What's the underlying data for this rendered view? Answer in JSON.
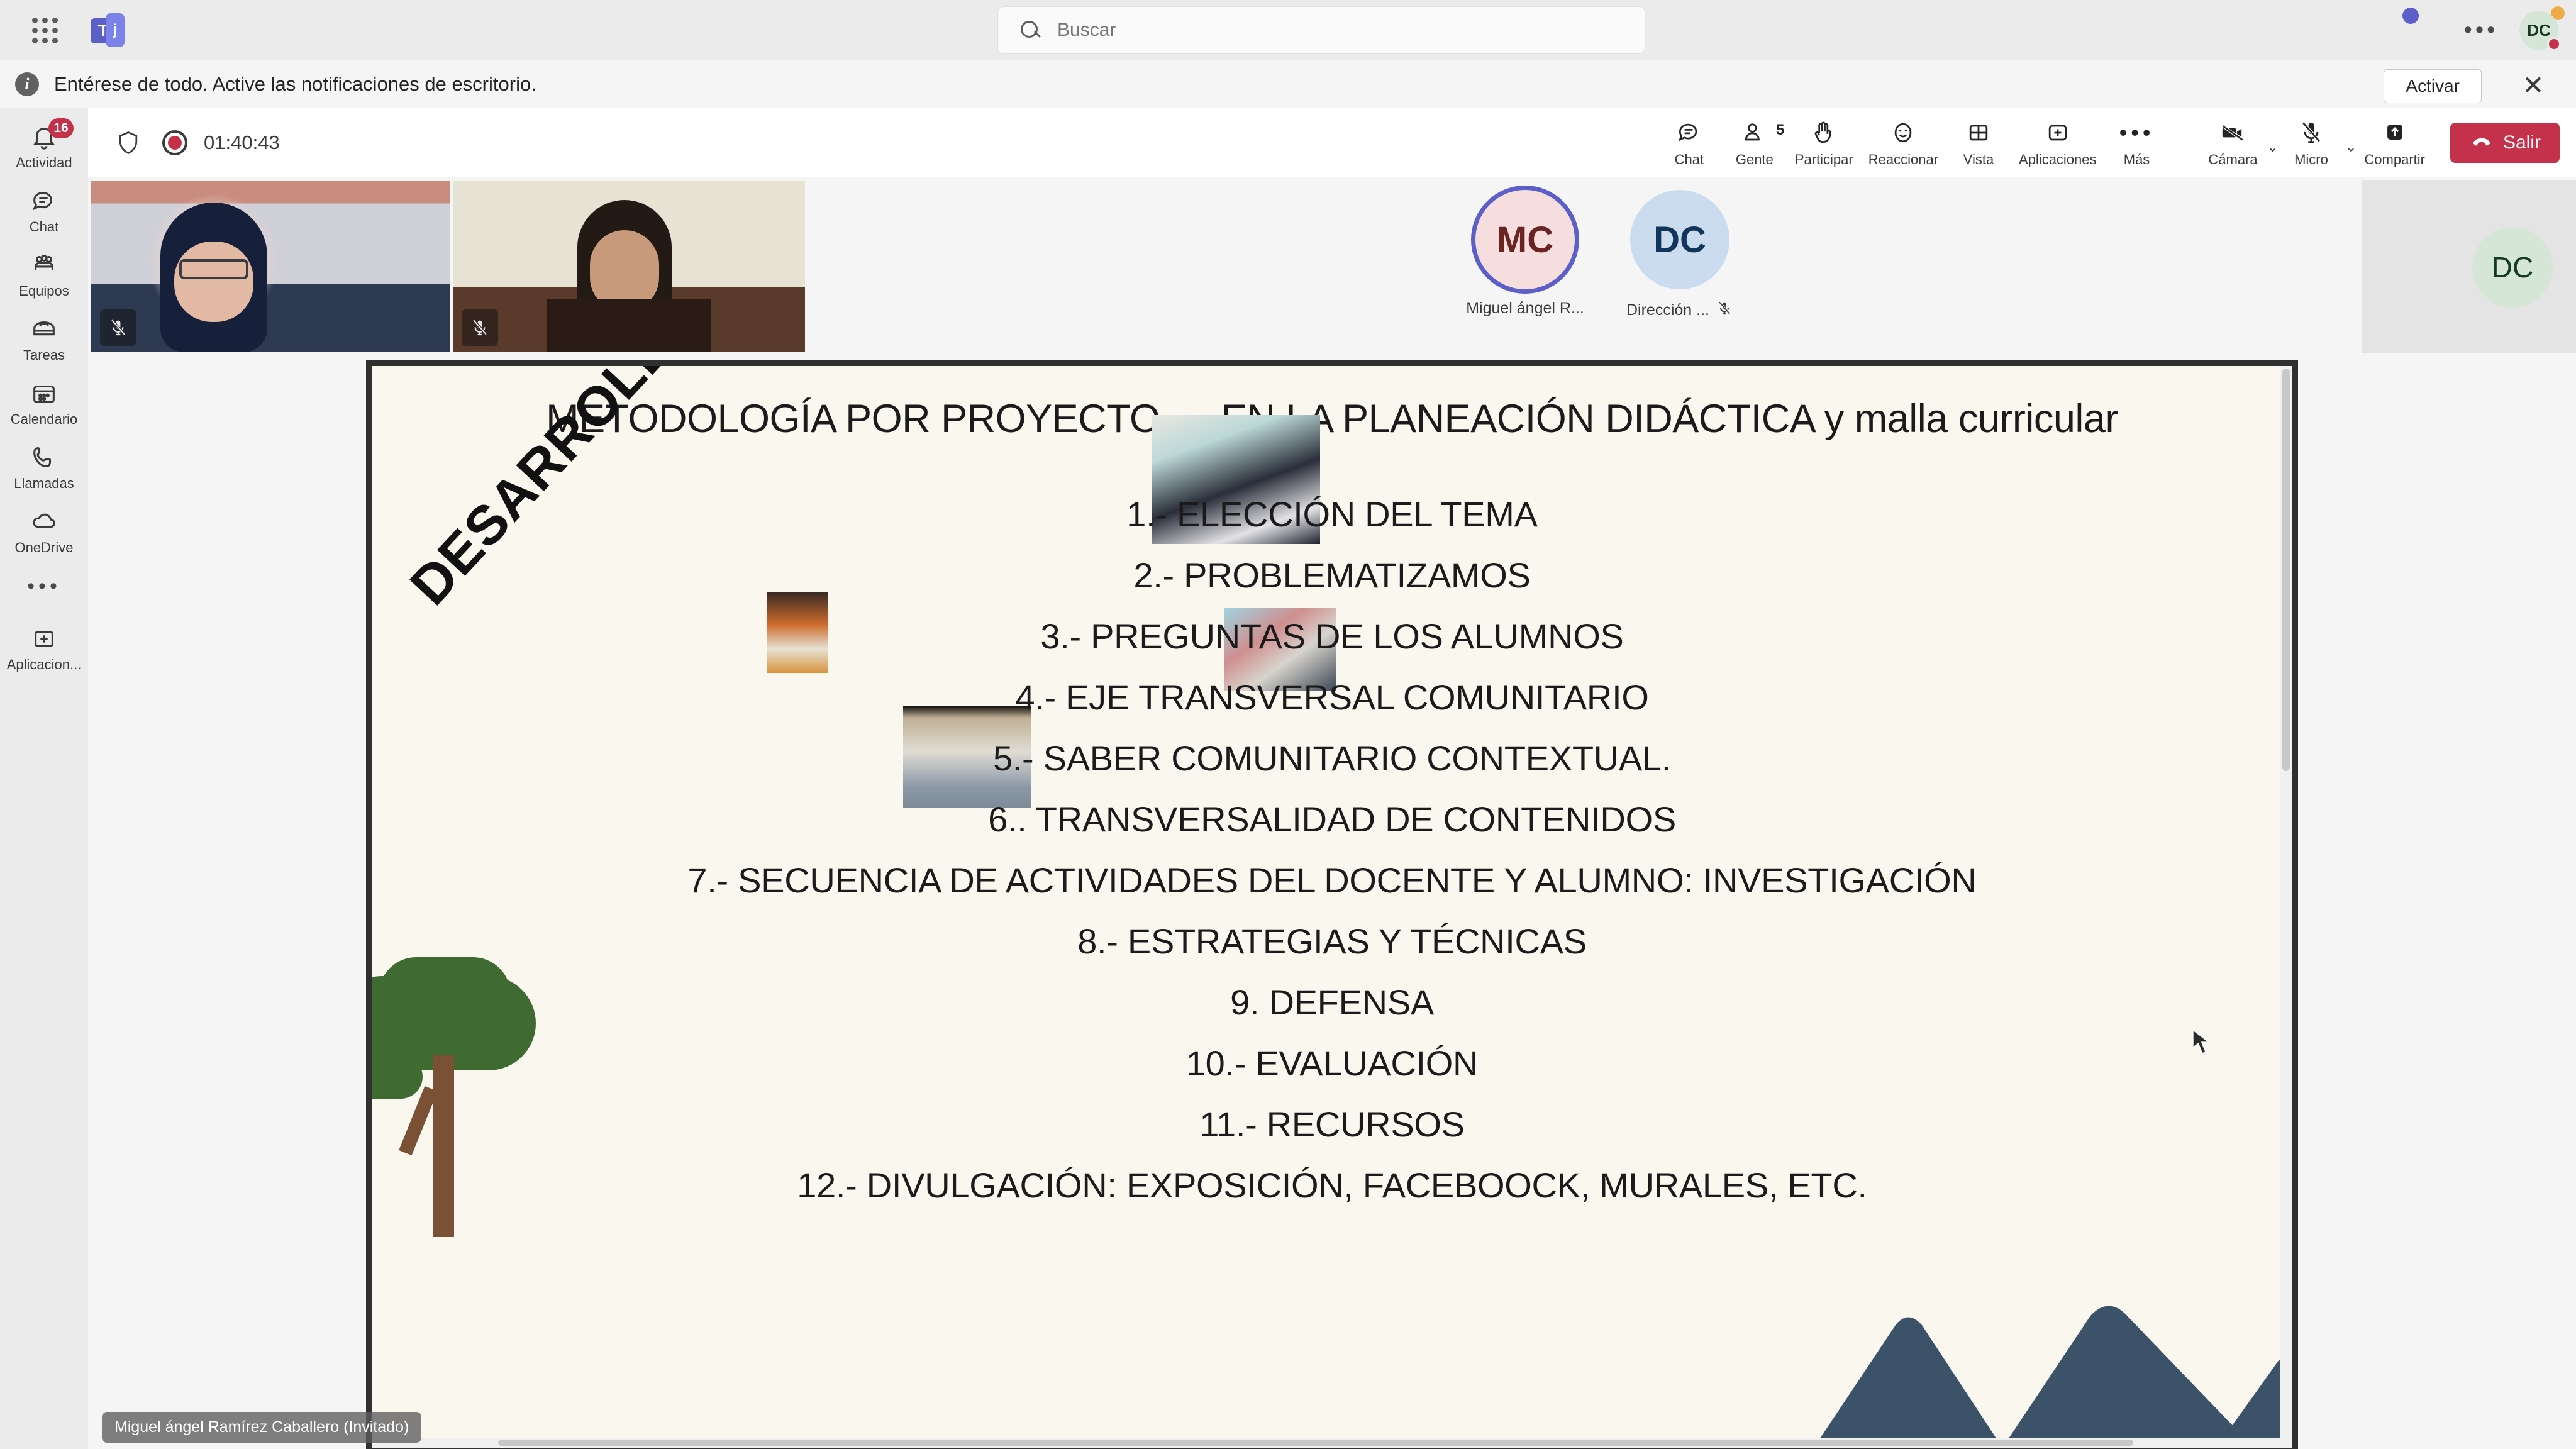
{
  "app": {
    "name": "Microsoft Teams",
    "logo_letter": "T"
  },
  "topbar": {
    "waffle_icon": "grid-waffle-icon",
    "search": {
      "placeholder": "Buscar",
      "value": "",
      "icon": "search-icon"
    },
    "more_icon": "ellipsis-icon",
    "account_initials": "DC",
    "presence": "busy"
  },
  "notification": {
    "icon": "info-icon",
    "text": "Entérese de todo. Active las notificaciones de escritorio.",
    "action_label": "Activar",
    "close_icon": "close-icon"
  },
  "sidebar": {
    "items": [
      {
        "label": "Actividad",
        "icon": "bell-icon",
        "badge": "16"
      },
      {
        "label": "Chat",
        "icon": "chat-bubble-icon",
        "badge": ""
      },
      {
        "label": "Equipos",
        "icon": "people-team-icon",
        "badge": ""
      },
      {
        "label": "Tareas",
        "icon": "briefcase-icon",
        "badge": ""
      },
      {
        "label": "Calendario",
        "icon": "calendar-icon",
        "badge": ""
      },
      {
        "label": "Llamadas",
        "icon": "phone-icon",
        "badge": ""
      },
      {
        "label": "OneDrive",
        "icon": "cloud-icon",
        "badge": ""
      }
    ],
    "more_icon": "ellipsis-icon",
    "apps": {
      "label": "Aplicacion...",
      "icon": "plus-box-icon"
    }
  },
  "meeting_toolbar": {
    "shield_icon": "shield-icon",
    "recording_icon": "recording-dot-icon",
    "timer": "01:40:43",
    "buttons": [
      {
        "label": "Chat",
        "icon": "chat-bubble-icon",
        "count": ""
      },
      {
        "label": "Gente",
        "icon": "person-icon",
        "count": "5"
      },
      {
        "label": "Participar",
        "icon": "raise-hand-icon",
        "count": ""
      },
      {
        "label": "Reaccionar",
        "icon": "smiley-icon",
        "count": ""
      },
      {
        "label": "Vista",
        "icon": "grid-view-icon",
        "count": ""
      },
      {
        "label": "Aplicaciones",
        "icon": "plus-box-icon",
        "count": ""
      },
      {
        "label": "Más",
        "icon": "ellipsis-icon",
        "count": ""
      }
    ],
    "media": [
      {
        "label": "Cámara",
        "icon": "camera-off-icon",
        "has_chevron": true
      },
      {
        "label": "Micro",
        "icon": "mic-off-icon",
        "has_chevron": true
      },
      {
        "label": "Compartir",
        "icon": "share-up-arrow-icon",
        "has_chevron": false
      }
    ],
    "leave": {
      "label": "Salir",
      "icon": "hang-up-icon",
      "color": "#c4314b"
    }
  },
  "stage": {
    "video_tiles": [
      {
        "name": "",
        "muted_icon": "mic-off-icon"
      },
      {
        "name": "",
        "muted_icon": "mic-off-icon"
      }
    ],
    "participants": [
      {
        "initials": "MC",
        "name": "Miguel ángel R...",
        "speaking": true,
        "muted": false
      },
      {
        "initials": "DC",
        "name": "Dirección ...",
        "speaking": false,
        "muted": true,
        "muted_icon": "mic-off-icon"
      }
    ],
    "right_tile": {
      "initials": "DC"
    },
    "active_speaker_label": "Miguel ángel Ramírez Caballero (Invitado)",
    "cursor_icon": "mouse-pointer-icon"
  },
  "slide": {
    "title": "METODOLOGÍA POR PROYECTO…. EN LA PLANEACIÓN DIDÁCTICA y malla curricular",
    "rotated_label": "DESARROLLO",
    "items": [
      "1.- ELECCIÓN DEL TEMA",
      "2.- PROBLEMATIZAMOS",
      "3.- PREGUNTAS DE LOS ALUMNOS",
      "4.- EJE TRANSVERSAL COMUNITARIO",
      "5.- SABER COMUNITARIO CONTEXTUAL.",
      "6.. TRANSVERSALIDAD DE CONTENIDOS",
      "7.- SECUENCIA DE ACTIVIDADES DEL DOCENTE Y ALUMNO:  INVESTIGACIÓN",
      "8.- ESTRATEGIAS Y TÉCNICAS",
      "9. DEFENSA",
      "10.- EVALUACIÓN",
      "11.- RECURSOS",
      "12.-  DIVULGACIÓN: EXPOSICIÓN, FACEBOOCK, MURALES, ETC."
    ],
    "background_color": "#faf7ef",
    "decorations": {
      "tree_icon": "tree-illustration",
      "mountains_icon": "mountains-illustration",
      "photos": [
        "photo-students-screenprinting",
        "photo-child-drawing",
        "photo-students-group",
        "photo-teachers-assembly"
      ]
    }
  }
}
